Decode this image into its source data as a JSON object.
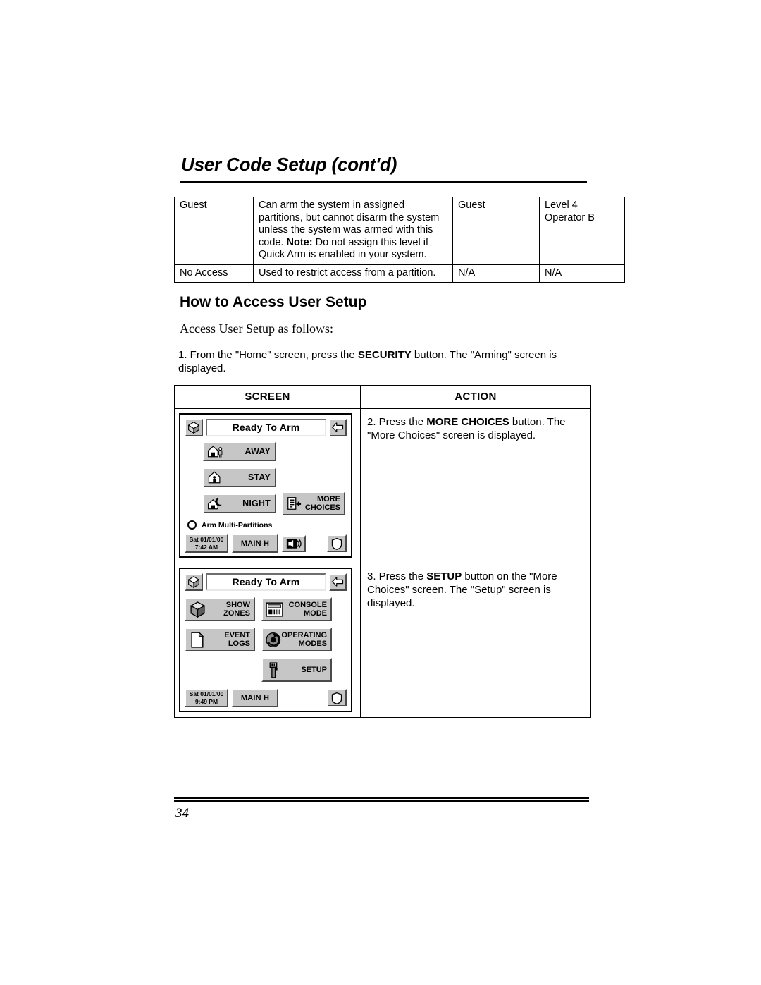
{
  "header": {
    "title": "User Code Setup (cont'd)"
  },
  "authority_table": {
    "rows": [
      {
        "level": "Guest",
        "description_lines": [
          "Can arm the system in assigned",
          "partitions, but cannot disarm the",
          "system unless the system was",
          "armed with this code."
        ],
        "note_label": "Note:",
        "note_text": " Do not assign this level if Quick Arm is enabled in your system.",
        "col3": "Guest",
        "col4_line1": "Level 4",
        "col4_line2": "Operator B"
      },
      {
        "level": "No Access",
        "description_lines": [
          "Used to restrict access from a",
          "partition."
        ],
        "note_label": "",
        "note_text": "",
        "col3": "N/A",
        "col4_line1": "N/A",
        "col4_line2": ""
      }
    ]
  },
  "section": {
    "heading": "How to Access User Setup",
    "lead": "Access User Setup as follows:",
    "step1_a": "1.  From the \"Home\" screen, press the ",
    "step1_bold": "SECURITY",
    "step1_b": " button.  The \"Arming\" screen is displayed."
  },
  "procedure_table": {
    "headers": {
      "screen": "SCREEN",
      "action": "ACTION"
    },
    "rows": [
      {
        "action_a": "2.  Press the ",
        "action_bold": "MORE CHOICES",
        "action_b": " button. The \"More Choices\" screen is displayed."
      },
      {
        "action_a": "3.  Press the ",
        "action_bold": "SETUP",
        "action_b": " button on the \"More Choices\" screen.  The \"Setup\" screen is displayed."
      }
    ]
  },
  "panel_arming": {
    "home_icon": "home-cube-icon",
    "back_icon": "back-arrow-icon",
    "status": "Ready To Arm",
    "buttons": [
      {
        "label": "AWAY",
        "icon": "house-person-icon"
      },
      {
        "label": "STAY",
        "icon": "house-inside-icon"
      },
      {
        "label": "NIGHT",
        "icon": "house-moon-icon"
      }
    ],
    "more_choices": {
      "line1": "MORE",
      "line2": "CHOICES",
      "icon": "list-plus-icon"
    },
    "multi_partition_label": "Arm Multi-Partitions",
    "statusbar": {
      "date": "Sat 01/01/00",
      "time": "7:42 AM",
      "partition": "MAIN H",
      "speaker_icon": "speaker-icon",
      "shield_icon": "shield-icon"
    }
  },
  "panel_more_choices": {
    "home_icon": "home-cube-icon",
    "back_icon": "back-arrow-icon",
    "status": "Ready To Arm",
    "buttons": [
      {
        "line1": "SHOW",
        "line2": "ZONES",
        "icon": "cube-icon"
      },
      {
        "line1": "CONSOLE",
        "line2": "MODE",
        "icon": "keypad-icon"
      },
      {
        "line1": "EVENT",
        "line2": "LOGS",
        "icon": "page-icon"
      },
      {
        "line1": "OPERATING",
        "line2": "MODES",
        "icon": "dial-icon"
      },
      {
        "line1": "",
        "line2": "SETUP",
        "icon": "wrench-icon"
      }
    ],
    "statusbar": {
      "date": "Sat 01/01/00",
      "time": "9:49 PM",
      "partition": "MAIN H",
      "shield_icon": "shield-icon"
    }
  },
  "footer": {
    "page_number": "34"
  }
}
